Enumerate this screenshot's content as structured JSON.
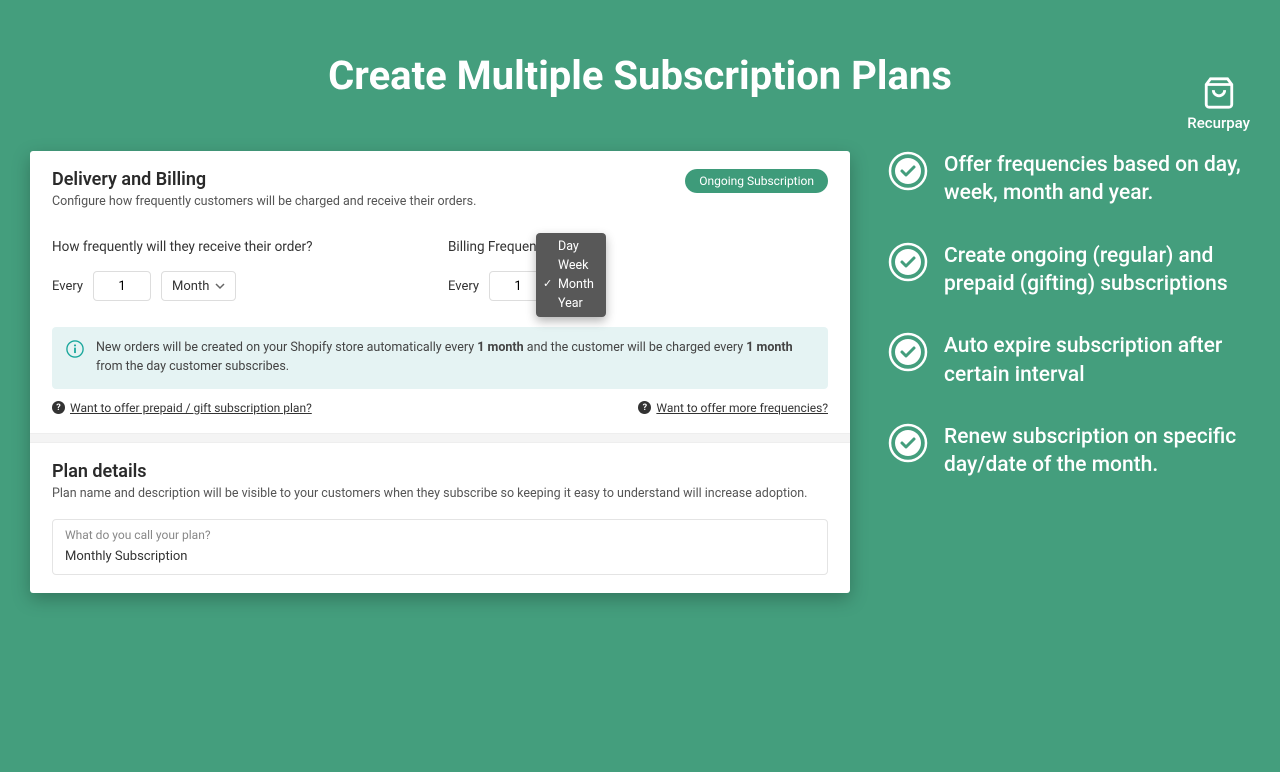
{
  "brand": {
    "name": "Recurpay"
  },
  "page": {
    "title": "Create Multiple Subscription Plans"
  },
  "panel": {
    "delivery": {
      "title": "Delivery and Billing",
      "subtitle": "Configure how frequently customers will be charged and receive their orders.",
      "badge": "Ongoing Subscription",
      "order_frequency_label": "How frequently will they receive their order?",
      "billing_frequency_label": "Billing Frequency",
      "every_label": "Every",
      "order_qty": "1",
      "order_unit": "Month",
      "billing_qty": "1",
      "dropdown": {
        "options": [
          "Day",
          "Week",
          "Month",
          "Year"
        ],
        "selected": "Month"
      },
      "info_prefix": "New orders will be created on your Shopify store automatically every ",
      "info_bold1": "1 month",
      "info_mid": " and the customer will be charged every ",
      "info_bold2": "1 month",
      "info_suffix": " from the day customer subscribes.",
      "help_left": "Want to offer prepaid / gift subscription plan?",
      "help_right": "Want to offer more frequencies?"
    },
    "plan_details": {
      "title": "Plan details",
      "subtitle": "Plan name and description will be visible to your customers when they subscribe so keeping it easy to understand will increase adoption.",
      "input_label": "What do you call your plan?",
      "input_value": "Monthly Subscription"
    }
  },
  "bullets": [
    "Offer frequencies based on day, week, month and year.",
    "Create ongoing (regular) and prepaid (gifting) subscriptions",
    "Auto expire subscription after certain interval",
    "Renew subscription on specific day/date of the month."
  ]
}
